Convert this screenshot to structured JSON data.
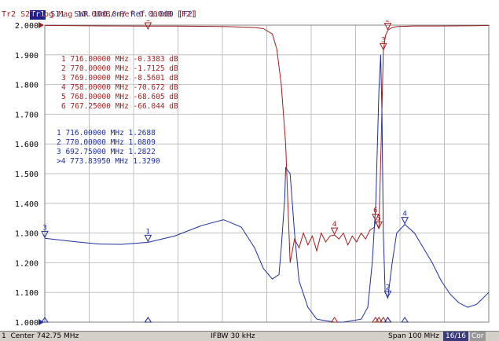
{
  "header": {
    "tr1_badge": "Tr1",
    "tr1_text": " S11  SWR 100.0m/ Ref 1.000 [F2]",
    "tr2_text": "Tr2 S21 Log Mag 10.00dB/ Ref 0.000dB [F2]"
  },
  "colors": {
    "tr1": "#1f2f9f",
    "tr2": "#9f1f1f",
    "grid": "#c0c0c0",
    "axis": "#000000"
  },
  "yaxis_labels": [
    "2.000",
    "1.900",
    "1.800",
    "1.700",
    "1.600",
    "1.500",
    "1.400",
    "1.300",
    "1.200",
    "1.100",
    "1.000"
  ],
  "marker_table_tr2": [
    "1   716.00000  MHz  -0.3383  dB",
    "2   770.00000  MHz  -1.7125  dB",
    "3   769.00000  MHz  -8.5601  dB",
    "4   758.00000  MHz  -70.672  dB",
    "5   768.00000  MHz  -68.605  dB",
    "6   767.25000  MHz  -66.044  dB"
  ],
  "marker_table_tr1": [
    " 1   716.00000  MHz  1.2688",
    " 2   770.00000  MHz  1.0809",
    " 3   692.75000  MHz  1.2822",
    ">4   773.83950  MHz  1.3290"
  ],
  "status": {
    "left": "1  Center 742.75 MHz",
    "mid": "IFBW 30 kHz",
    "right": "Span 100 MHz",
    "count": "16/16",
    "cor": "Cor"
  },
  "chart_data": {
    "type": "line",
    "x_range_mhz": [
      692.75,
      792.75
    ],
    "series": [
      {
        "name": "Tr1 S11 SWR",
        "x": [
          692.75,
          700,
          705,
          710,
          716,
          722,
          728,
          733,
          737,
          740,
          742,
          744,
          745.5,
          746,
          746.8,
          747,
          748,
          749,
          750,
          752,
          754,
          756,
          758,
          760,
          762,
          764,
          765.5,
          766.5,
          767.3,
          768,
          768.4,
          768.7,
          769,
          769.4,
          770,
          771,
          772,
          773.84,
          776,
          778,
          780,
          782,
          784,
          786,
          788,
          790,
          792.75
        ],
        "y": [
          1.2822,
          1.27,
          1.263,
          1.262,
          1.2688,
          1.29,
          1.325,
          1.345,
          1.32,
          1.25,
          1.18,
          1.145,
          1.16,
          1.25,
          1.42,
          1.52,
          1.5,
          1.3,
          1.14,
          1.05,
          1.01,
          1.005,
          1.0,
          1.0,
          1.005,
          1.01,
          1.05,
          1.2,
          1.4,
          1.78,
          1.9,
          1.7,
          1.3,
          1.1,
          1.0809,
          1.2,
          1.3,
          1.329,
          1.3,
          1.25,
          1.2,
          1.14,
          1.095,
          1.065,
          1.05,
          1.06,
          1.1
        ]
      },
      {
        "name": "Tr2 S21 Log Mag",
        "x": [
          692.75,
          700,
          710,
          716,
          722,
          728,
          734,
          740,
          742,
          744,
          745,
          746,
          747,
          748,
          749,
          750,
          751,
          752,
          753,
          754,
          755,
          756,
          757,
          758,
          759,
          760,
          761,
          762,
          763,
          764,
          765,
          766,
          767,
          767.25,
          768,
          768.5,
          769,
          769.5,
          770,
          771,
          772,
          776,
          782,
          790,
          792.75
        ],
        "y": [
          -0.1,
          -0.2,
          -0.3,
          -0.3383,
          -0.35,
          -0.4,
          -0.5,
          -0.8,
          -1.2,
          -3.0,
          -8.0,
          -20.0,
          -40.0,
          -80,
          -72,
          -75,
          -70,
          -74,
          -71,
          -76,
          -70,
          -73,
          -71,
          -70.672,
          -72,
          -70,
          -74,
          -71,
          -73,
          -70,
          -72,
          -69,
          -68,
          -66.044,
          -68.605,
          -40,
          -8.5601,
          -3.5,
          -1.7125,
          -0.8,
          -0.5,
          -0.3,
          -0.3,
          -0.2,
          -0.1
        ]
      }
    ],
    "tr1_ylim": [
      1.0,
      2.0
    ],
    "tr2_ylim": [
      -100,
      0
    ],
    "grid": true,
    "tr1_markers": [
      {
        "label": "1",
        "x": 716.0,
        "y": 1.2688
      },
      {
        "label": "2",
        "x": 770.0,
        "y": 1.0809
      },
      {
        "label": "3",
        "x": 692.75,
        "y": 1.2822
      },
      {
        "label": "4",
        "x": 773.8395,
        "y": 1.329
      }
    ],
    "tr2_markers": [
      {
        "label": "1",
        "x": 716.0,
        "y": -0.3383
      },
      {
        "label": "2",
        "x": 770.0,
        "y": -1.7125
      },
      {
        "label": "3",
        "x": 769.0,
        "y": -8.5601
      },
      {
        "label": "4",
        "x": 758.0,
        "y": -70.672
      },
      {
        "label": "5",
        "x": 768.0,
        "y": -68.605
      },
      {
        "label": "6",
        "x": 767.25,
        "y": -66.044
      }
    ]
  }
}
